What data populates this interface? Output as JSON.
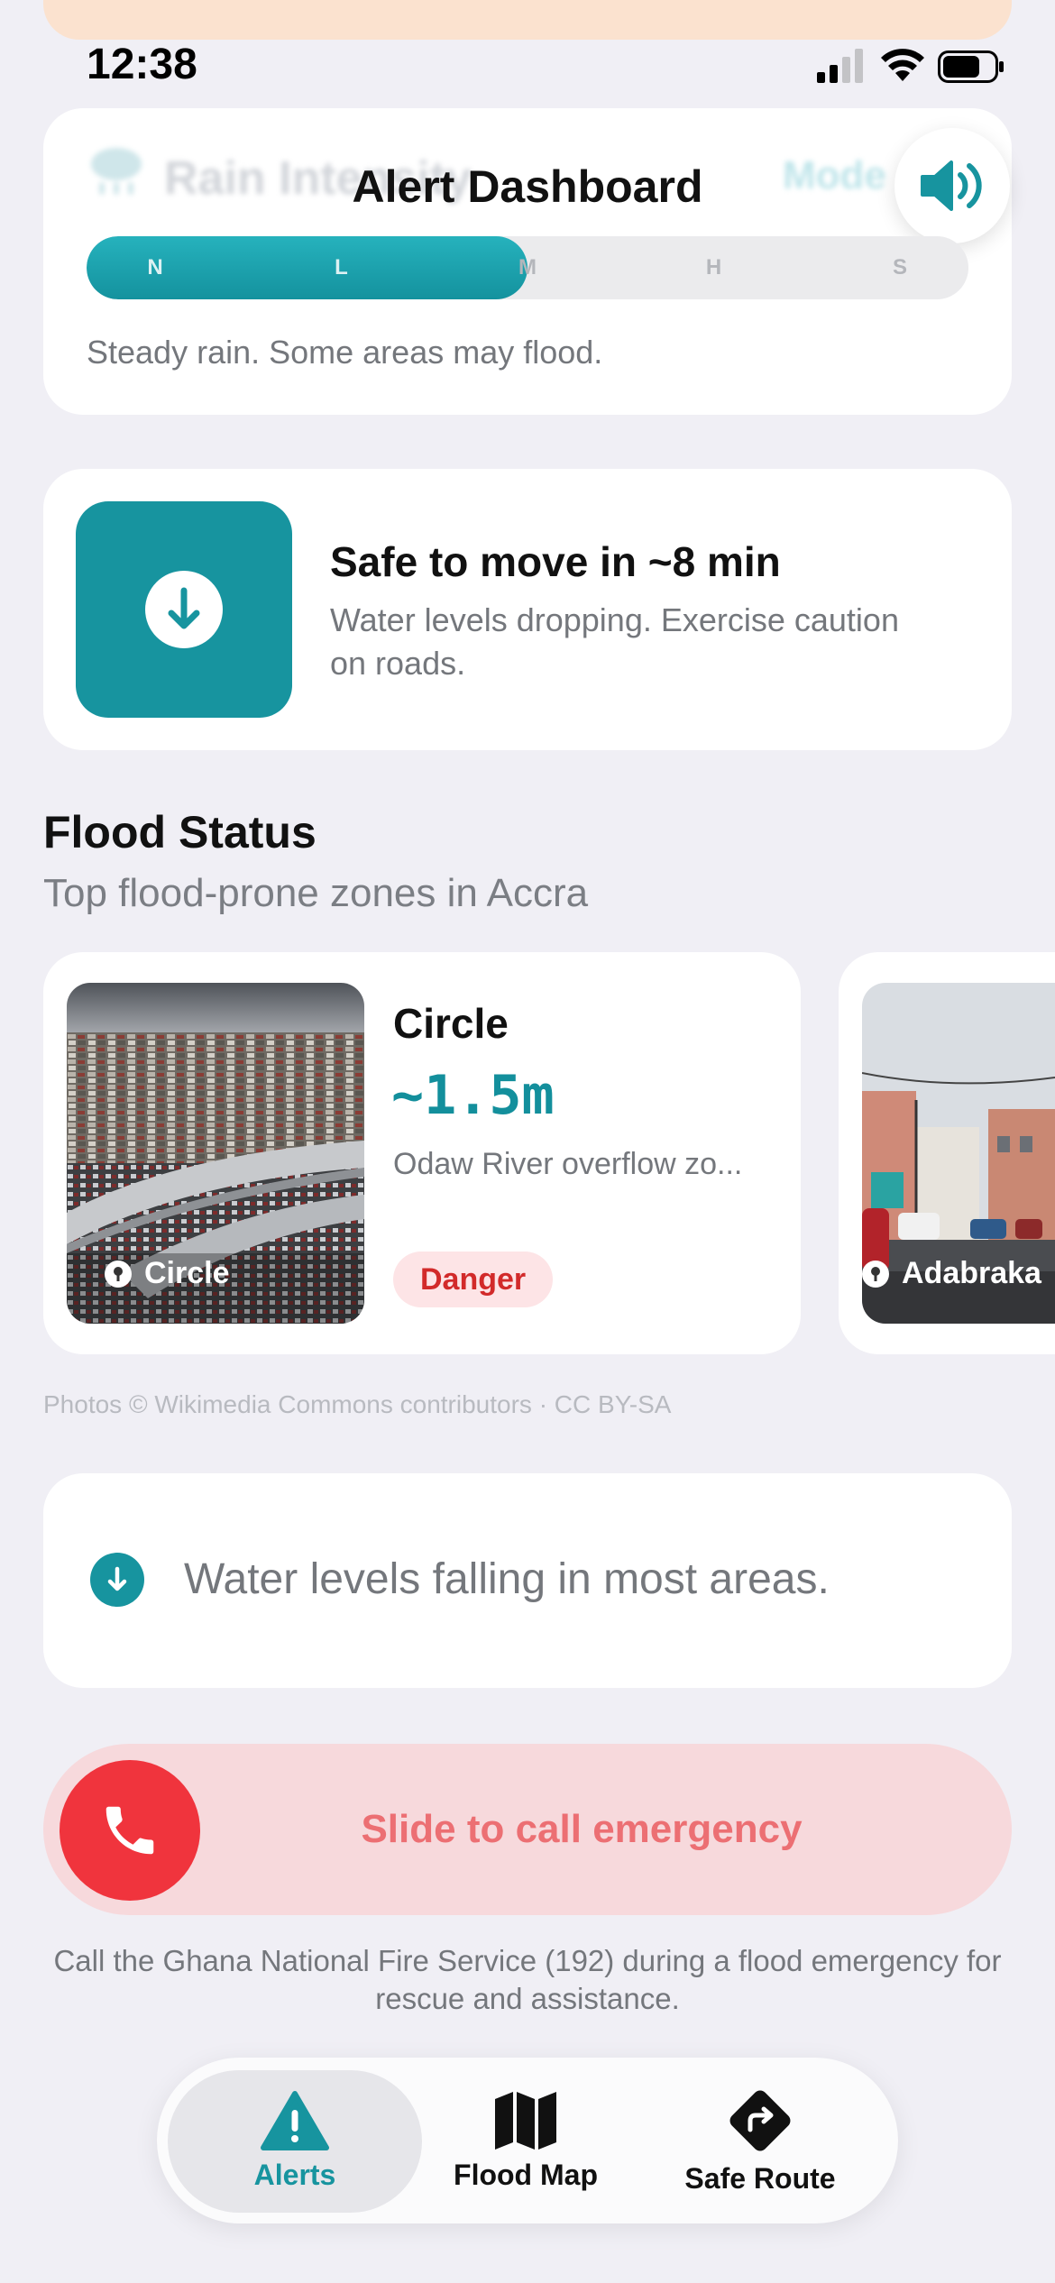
{
  "status_bar": {
    "time": "12:38"
  },
  "header": {
    "title": "Alert Dashboard",
    "speaker_icon": "speaker-volume-icon"
  },
  "rain_card": {
    "title": "Rain Intensity",
    "mode_label": "Mode",
    "levels": [
      "N",
      "L",
      "M",
      "H",
      "S"
    ],
    "current_level": "L",
    "fill_fraction": 0.5,
    "description": "Steady rain. Some areas may flood."
  },
  "safe_card": {
    "title": "Safe to move in ~8 min",
    "description": "Water levels dropping. Exercise caution on roads.",
    "icon": "arrow-down-circle-icon"
  },
  "flood_status": {
    "title": "Flood Status",
    "subtitle": "Top flood-prone zones in Accra",
    "zones": [
      {
        "photo_label": "Circle",
        "name": "Circle",
        "level": "~1.5m",
        "description": "Odaw River overflow zo...",
        "status": "Danger"
      },
      {
        "photo_label": "Adabraka"
      }
    ],
    "credit": "Photos © Wikimedia Commons contributors · CC BY-SA"
  },
  "info_banner": {
    "text": "Water levels falling in most areas."
  },
  "emergency": {
    "slide_label": "Slide to call emergency",
    "help_text": "Call the Ghana National Fire Service (192) during a flood emergency for rescue and assistance."
  },
  "tabs": [
    {
      "label": "Alerts",
      "icon": "warning-triangle-icon",
      "active": true
    },
    {
      "label": "Flood Map",
      "icon": "map-icon",
      "active": false
    },
    {
      "label": "Safe Route",
      "icon": "route-diamond-icon",
      "active": false
    }
  ],
  "colors": {
    "accent": "#17949f",
    "danger": "#f0343d",
    "background": "#f0eff5"
  }
}
